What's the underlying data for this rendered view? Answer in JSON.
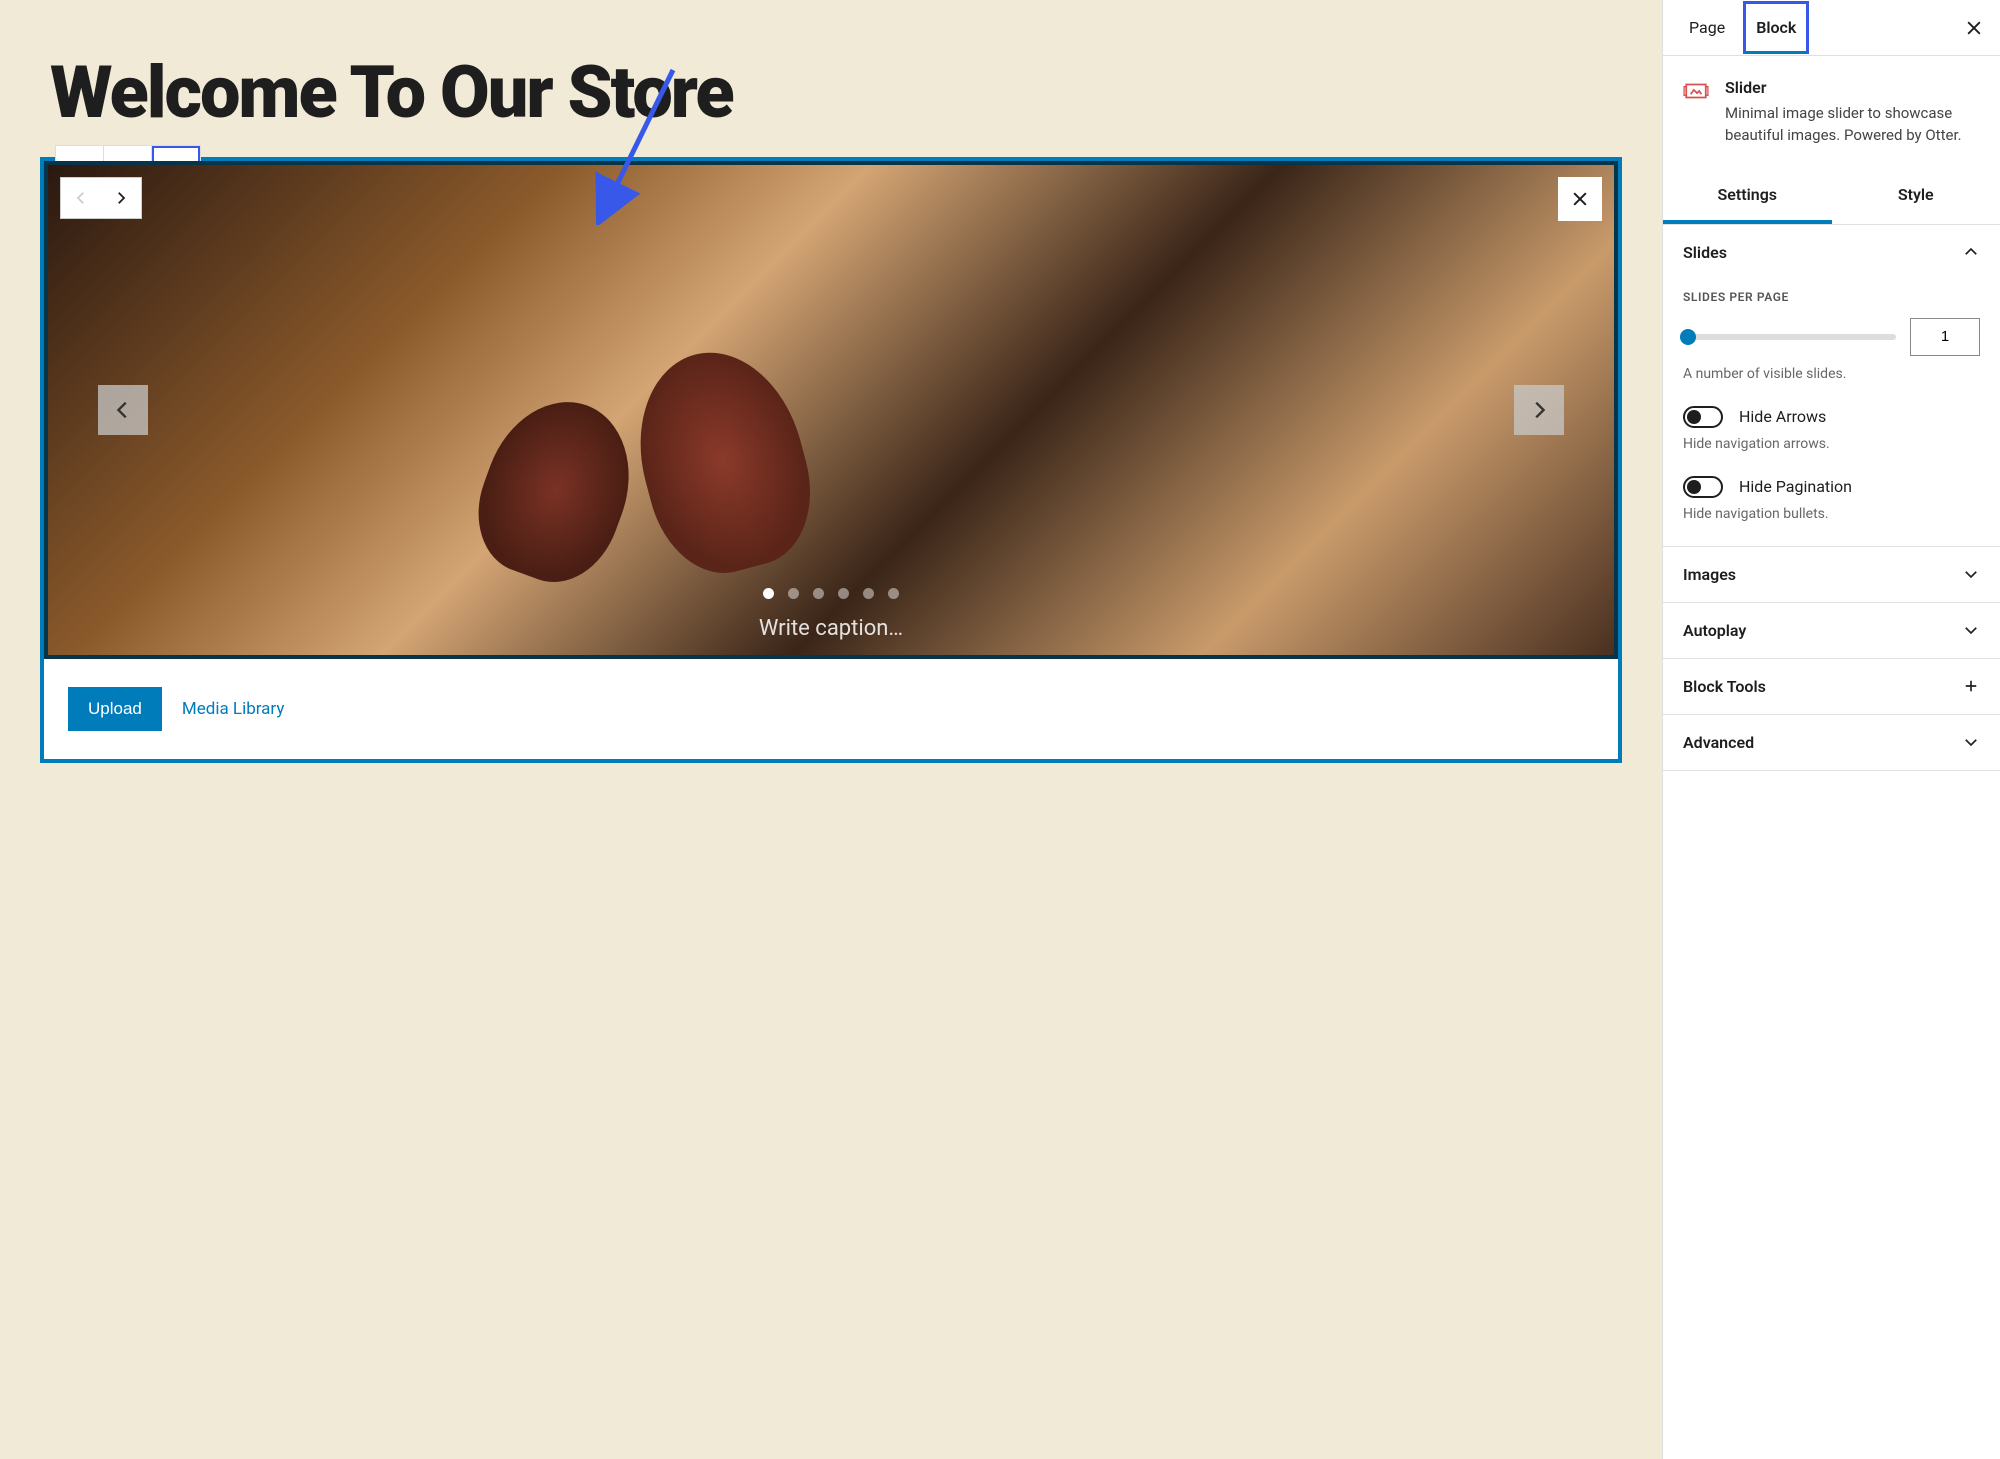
{
  "page_title": "Welcome To Our Store",
  "block_toolbar": {
    "icons": [
      "slider-icon",
      "align-icon",
      "more-icon"
    ]
  },
  "slider": {
    "caption_placeholder": "Write caption…",
    "dots_count": 6,
    "active_dot": 0
  },
  "media": {
    "upload": "Upload",
    "library": "Media Library"
  },
  "sidebar": {
    "tabs": {
      "page": "Page",
      "block": "Block"
    },
    "block_info": {
      "title": "Slider",
      "desc": "Minimal image slider to showcase beautiful images. Powered by Otter."
    },
    "sub_tabs": {
      "settings": "Settings",
      "style": "Style"
    },
    "panels": {
      "slides": {
        "title": "Slides",
        "field_label": "SLIDES PER PAGE",
        "value": "1",
        "help": "A number of visible slides.",
        "hide_arrows": {
          "label": "Hide Arrows",
          "help": "Hide navigation arrows."
        },
        "hide_pagination": {
          "label": "Hide Pagination",
          "help": "Hide navigation bullets."
        }
      },
      "images": "Images",
      "autoplay": "Autoplay",
      "block_tools": "Block Tools",
      "advanced": "Advanced"
    }
  }
}
